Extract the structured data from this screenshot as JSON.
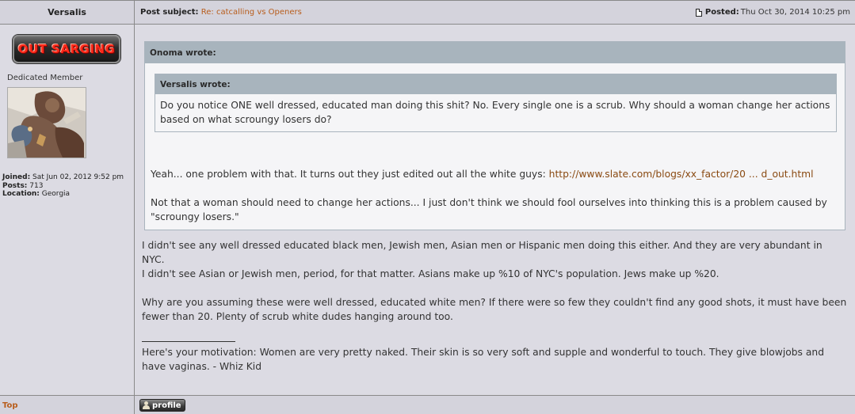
{
  "author": {
    "name": "Versalis",
    "rank_badge": "OUT SARGING",
    "rank_title": "Dedicated Member",
    "joined_label": "Joined:",
    "joined_value": "Sat Jun 02, 2012 9:52 pm",
    "posts_label": "Posts:",
    "posts_value": "713",
    "location_label": "Location:",
    "location_value": "Georgia",
    "avatar_icon": "avatar-icon"
  },
  "post": {
    "subject_label": "Post subject:",
    "subject": "Re: catcalling vs Openers",
    "posted_label": "Posted:",
    "posted_value": "Thu Oct 30, 2014 10:25 pm",
    "post_icon": "post-icon"
  },
  "quote_outer": {
    "header": "Onoma wrote:",
    "para1_prefix": "Yeah... one problem with that. It turns out they just edited out all the white guys:",
    "link": "http://www.slate.com/blogs/xx_factor/20 ... d_out.html",
    "para2": "Not that a woman should need to change her actions... I just don't think we should fool ourselves into thinking this is a problem caused by \"scroungy losers.\""
  },
  "quote_inner": {
    "header": "Versalis wrote:",
    "text": "Do you notice ONE well dressed, educated man doing this shit? No. Every single one is a scrub. Why should a woman change her actions based on what scroungy losers do?"
  },
  "reply": {
    "line1": "I didn't see any well dressed educated black men, Jewish men, Asian men or Hispanic men doing this either. And they are very abundant in NYC.",
    "line2": "I didn't see Asian or Jewish men, period, for that matter. Asians make up %10 of NYC's population. Jews make up %20.",
    "line3": "Why are you assuming these were well dressed, educated white men? If there were so few they couldn't find any good shots, it must have been fewer than 20. Plenty of scrub white dudes hanging around too."
  },
  "signature": {
    "text": "Here's your motivation: Women are very pretty naked. Their skin is so very soft and supple and wonderful to touch. They give blowjobs and have vaginas. - Whiz Kid"
  },
  "footer": {
    "top_link": "Top",
    "profile_button": "profile",
    "profile_icon": "user-icon"
  },
  "colors": {
    "page_bg": "#dcdbe3",
    "link": "#b85d1c",
    "quote_header": "#a8b4bd",
    "badge_text": "#ff2a1a"
  }
}
